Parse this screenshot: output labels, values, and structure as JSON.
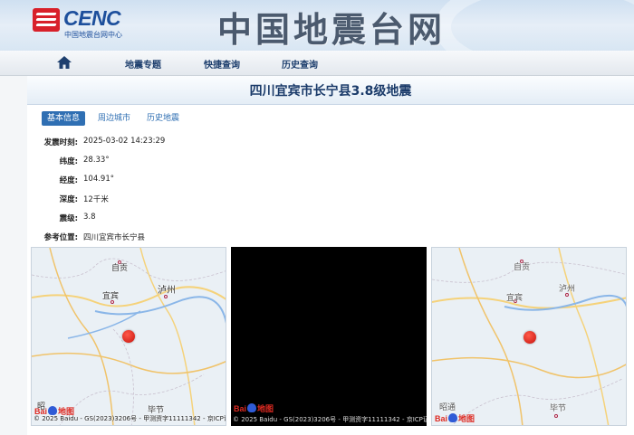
{
  "header": {
    "logo_text": "CENC",
    "logo_subtitle": "中国地震台网中心",
    "site_title": "中国地震台网"
  },
  "nav": {
    "home_icon": "home-icon",
    "items": [
      "地震专题",
      "快捷查询",
      "历史查询"
    ]
  },
  "event": {
    "title": "四川宜宾市长宁县3.8级地震"
  },
  "tabs": [
    "基本信息",
    "周边城市",
    "历史地震"
  ],
  "info": [
    {
      "label": "发震时刻:",
      "value": "2025-03-02 14:23:29"
    },
    {
      "label": "纬度:",
      "value": "28.33°"
    },
    {
      "label": "经度:",
      "value": "104.91°"
    },
    {
      "label": "深度:",
      "value": "12千米"
    },
    {
      "label": "震级:",
      "value": "3.8"
    },
    {
      "label": "参考位置:",
      "value": "四川宜宾市长宁县"
    }
  ],
  "maps": [
    {
      "cities": [
        "自贡",
        "泸州",
        "宜宾",
        "毕节",
        "昭"
      ],
      "copyright": "© 2025 Baidu - GS(2023)3206号 - 甲测资字11111342 - 京ICP证"
    },
    {
      "cities": [],
      "copyright": "© 2025 Baidu - GS(2023)3206号 - 甲测资字11111342 - 京ICP证"
    },
    {
      "cities": [
        "自贡",
        "泸州",
        "宜宾",
        "昭通",
        "毕节"
      ],
      "copyright": ""
    }
  ],
  "baidu": {
    "bai": "Bai",
    "di": "地图"
  },
  "colors": {
    "accent": "#2f6fb3",
    "title": "#1b3b6a",
    "epicenter": "#d8201a",
    "brand_red": "#d8202a"
  }
}
